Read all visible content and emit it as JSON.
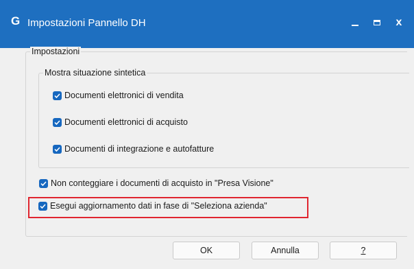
{
  "window": {
    "app_logo": "G",
    "title": "Impostazioni Pannello DH",
    "close_glyph": "x",
    "title_bar_color": "#1e6fc0"
  },
  "settings_group": {
    "label": "Impostazioni",
    "summary_group": {
      "label": "Mostra situazione sintetica",
      "options": [
        {
          "label": "Documenti elettronici di vendita",
          "checked": true
        },
        {
          "label": "Documenti elettronici di acquisto",
          "checked": true
        },
        {
          "label": "Documenti di integrazione e autofatture",
          "checked": true
        }
      ]
    },
    "options": [
      {
        "label": "Non conteggiare i documenti di acquisto in \"Presa Visione\"",
        "checked": true
      },
      {
        "label": "Esegui aggiornamento dati in fase di \"Seleziona azienda\"",
        "checked": true,
        "highlighted": true
      }
    ]
  },
  "buttons": {
    "ok": "OK",
    "cancel": "Annulla",
    "help": "?"
  },
  "colors": {
    "checkbox": "#1667bf",
    "highlight": "#e0252f"
  }
}
